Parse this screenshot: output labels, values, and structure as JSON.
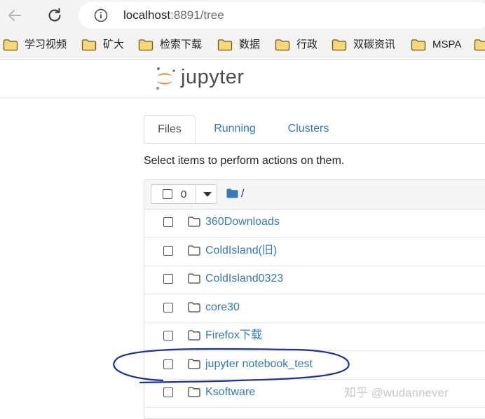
{
  "browser": {
    "url_host": "localhost",
    "url_rest": ":8891/tree",
    "bookmarks": [
      "学习视频",
      "矿大",
      "检索下载",
      "数据",
      "行政",
      "双碳资讯",
      "MSPA",
      ""
    ]
  },
  "app": {
    "logo_text": "jupyter"
  },
  "tabs": [
    {
      "label": "Files",
      "active": true
    },
    {
      "label": "Running",
      "active": false
    },
    {
      "label": "Clusters",
      "active": false
    }
  ],
  "hint_text": "Select items to perform actions on them.",
  "selection": {
    "count": "0"
  },
  "breadcrumb": "/",
  "files": [
    {
      "name": "360Downloads",
      "type": "folder"
    },
    {
      "name": "ColdIsland(旧)",
      "type": "folder"
    },
    {
      "name": "ColdIsland0323",
      "type": "folder"
    },
    {
      "name": "core30",
      "type": "folder"
    },
    {
      "name": "Firefox下载",
      "type": "folder"
    },
    {
      "name": "jupyter notebook_test",
      "type": "folder",
      "circled": true
    },
    {
      "name": "Ksoftware",
      "type": "folder"
    }
  ],
  "watermark": "知乎 @wudannever",
  "colors": {
    "link": "#337ab7",
    "jupyter_orange": "#f37726",
    "annotation_ink": "#1a2fa8",
    "bookmark_folder": "#f4c430"
  }
}
